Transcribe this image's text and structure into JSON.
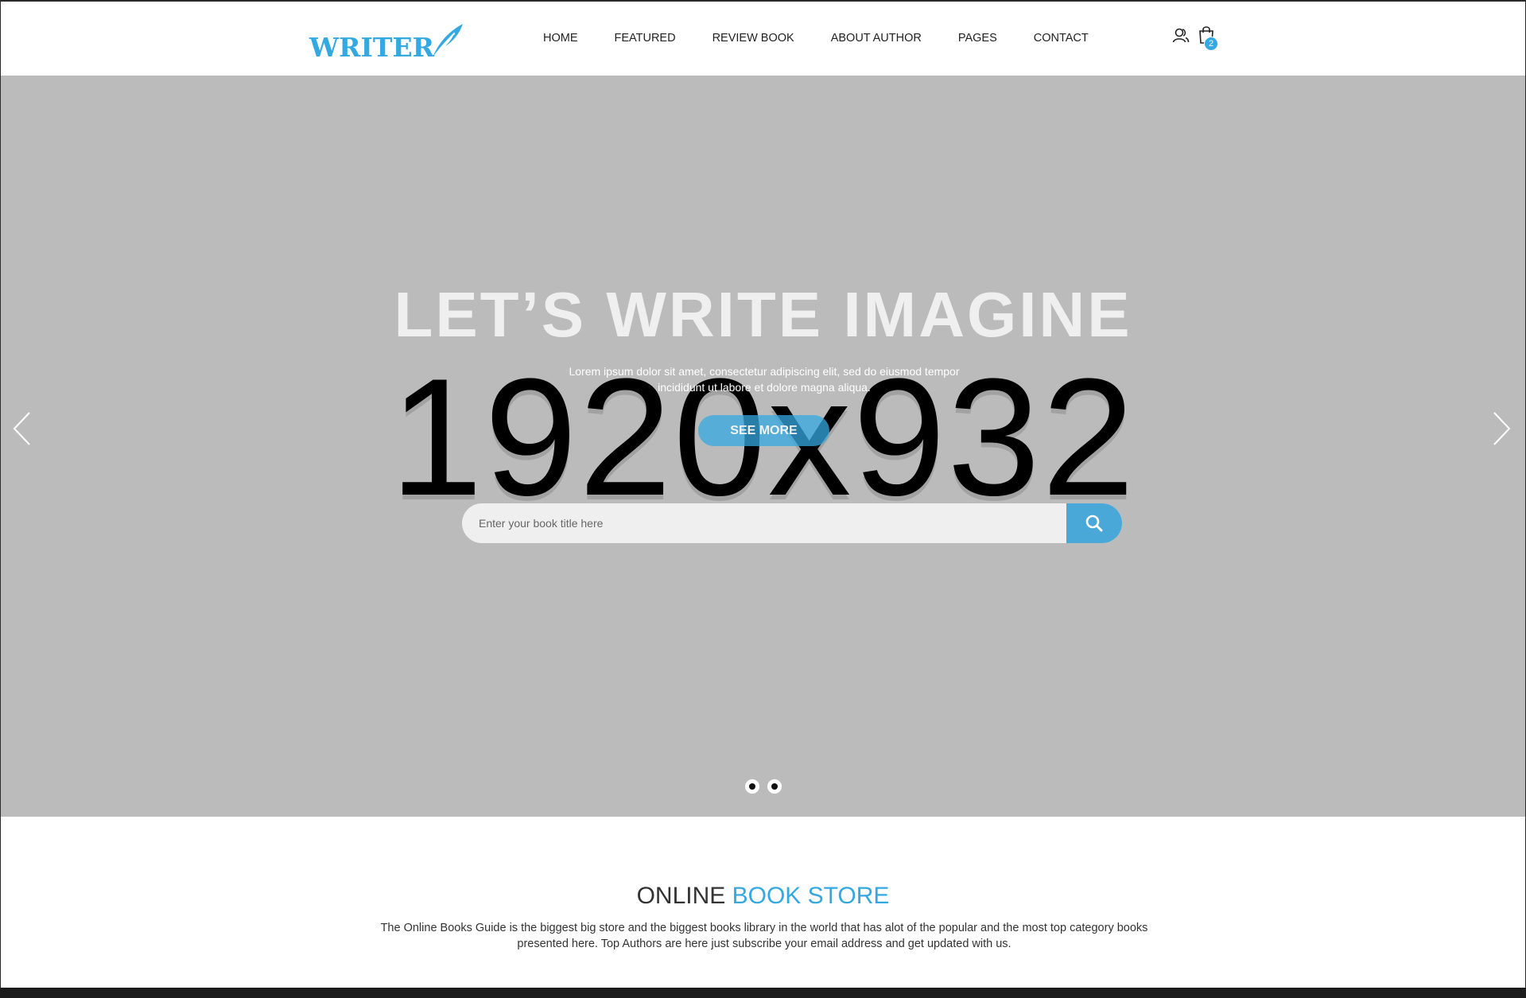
{
  "header": {
    "logo_text": "WRITER",
    "nav": [
      "HOME",
      "FEATURED",
      "REVIEW BOOK",
      "ABOUT AUTHOR",
      "PAGES",
      "CONTACT"
    ],
    "cart_count": "2",
    "icons": [
      "user-icon",
      "cart-icon"
    ]
  },
  "hero": {
    "title": "LET’S WRITE IMAGINE",
    "subtitle": "Lorem ipsum dolor sit amet, consectetur adipiscing elit, sed do eiusmod tempor incididunt ut labore et dolore magna aliqua.",
    "button": "SEE MORE",
    "placeholder_image_text": "1920x932",
    "search_placeholder": "Enter your book title here",
    "slide_count": 2,
    "background": "#bbbbbb"
  },
  "store": {
    "title_part1": "ONLINE",
    "title_part2": "BOOK STORE",
    "description": "The Online Books Guide is the biggest big store and the biggest books library in the world that has alot of the popular and the most top category books presented here. Top Authors are here just subscribe your email address and get updated with us."
  },
  "colors": {
    "accent": "#34a8e0",
    "text": "#333333"
  }
}
